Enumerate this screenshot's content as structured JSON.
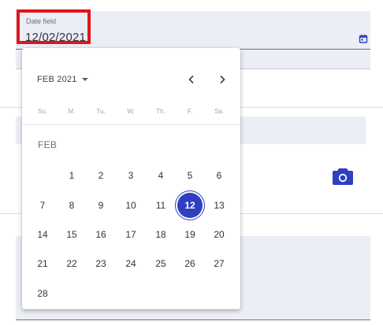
{
  "date_field": {
    "label": "Date field",
    "value": "12/02/2021",
    "icon": "calendar-icon"
  },
  "camera": {
    "icon": "camera-icon"
  },
  "accent_color": "#2f3fbf",
  "highlight_color": "#e0141a",
  "datepicker": {
    "month_label": "FEB 2021",
    "month_heading": "FEB",
    "prev_icon": "chevron-left-icon",
    "next_icon": "chevron-right-icon",
    "dropdown_icon": "caret-down-icon",
    "weekdays": [
      "Su.",
      "M.",
      "Tu.",
      "W.",
      "Th.",
      "F.",
      "Sa."
    ],
    "first_weekday_index": 1,
    "days_in_month": 28,
    "selected_day": "12"
  }
}
